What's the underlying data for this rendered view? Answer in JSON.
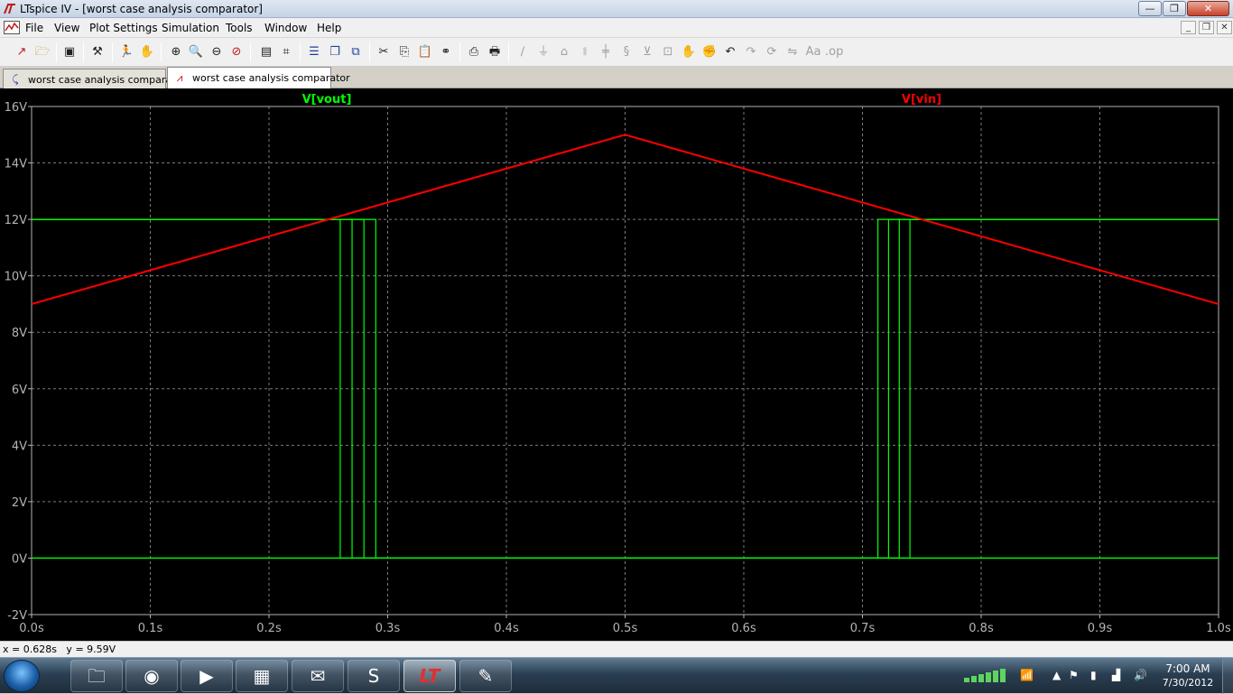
{
  "window": {
    "title": "LTspice IV - [worst case analysis comparator]",
    "minimize_glyph": "—",
    "maximize_glyph": "❐",
    "close_glyph": "✕"
  },
  "menu": {
    "items": [
      "File",
      "View",
      "Plot Settings",
      "Simulation",
      "Tools",
      "Window",
      "Help"
    ],
    "mdi_buttons": [
      "_",
      "❐",
      "✕"
    ]
  },
  "toolbar": {
    "icons": [
      "new-schematic-icon",
      "open-icon",
      "save-icon",
      "control-panel-icon",
      "run-icon",
      "halt-icon",
      "zoom-in-icon",
      "zoom-full-icon",
      "zoom-out-icon",
      "cancel-zoom-icon",
      "autorange-icon",
      "add-trace-icon",
      "tile-horizontal-icon",
      "cascade-icon",
      "close-all-icon",
      "cut-icon",
      "copy-icon",
      "paste-icon",
      "find-icon",
      "print-preview-icon",
      "print-icon",
      "wire-icon",
      "ground-icon",
      "label-icon",
      "resistor-icon",
      "capacitor-icon",
      "inductor-icon",
      "diode-icon",
      "component-icon",
      "move-icon",
      "drag-icon",
      "undo-icon",
      "redo-icon",
      "rotate-icon",
      "mirror-icon",
      "text-icon",
      "spice-directive-icon"
    ]
  },
  "tabs": [
    {
      "label": "worst case analysis comparator",
      "icon": "schematic-tab-icon",
      "active": false
    },
    {
      "label": "worst case analysis comparator",
      "icon": "waveform-tab-icon",
      "active": true
    }
  ],
  "plot": {
    "background": "#000000",
    "grid_color": "#7a7a7a",
    "axis_color": "#b4b4b4",
    "traces": [
      {
        "label": "V[vout]",
        "color": "#00ff00"
      },
      {
        "label": "V[vin]",
        "color": "#ff0000"
      }
    ]
  },
  "chart_data": {
    "type": "line",
    "title": "",
    "xlabel": "",
    "ylabel": "",
    "xlim": [
      0.0,
      1.0
    ],
    "ylim": [
      -2,
      16
    ],
    "x_ticks": [
      "0.0s",
      "0.1s",
      "0.2s",
      "0.3s",
      "0.4s",
      "0.5s",
      "0.6s",
      "0.7s",
      "0.8s",
      "0.9s",
      "1.0s"
    ],
    "x_tick_values": [
      0.0,
      0.1,
      0.2,
      0.3,
      0.4,
      0.5,
      0.6,
      0.7,
      0.8,
      0.9,
      1.0
    ],
    "y_ticks": [
      "-2V",
      "0V",
      "2V",
      "4V",
      "6V",
      "8V",
      "10V",
      "12V",
      "14V",
      "16V"
    ],
    "y_tick_values": [
      -2,
      0,
      2,
      4,
      6,
      8,
      10,
      12,
      14,
      16
    ],
    "grid": true,
    "legend": "top",
    "series": [
      {
        "name": "V[vin]",
        "color": "#ff0000",
        "x": [
          0.0,
          0.5,
          1.0
        ],
        "y": [
          9,
          15,
          9
        ]
      },
      {
        "name": "V[vout]",
        "color": "#00ff00",
        "step_groups": [
          {
            "x": [
              0.0,
              0.26,
              0.26,
              1.0
            ],
            "y": [
              12,
              12,
              0,
              0
            ]
          },
          {
            "x": [
              0.0,
              0.27,
              0.27,
              1.0
            ],
            "y": [
              12,
              12,
              0,
              0
            ]
          },
          {
            "x": [
              0.0,
              0.28,
              0.28,
              1.0
            ],
            "y": [
              12,
              12,
              0,
              0
            ]
          },
          {
            "x": [
              0.0,
              0.29,
              0.29,
              1.0
            ],
            "y": [
              12,
              12,
              0,
              0
            ]
          },
          {
            "x": [
              0.0,
              0.0,
              0.713,
              0.713,
              1.0
            ],
            "y": [
              0,
              0,
              0,
              12,
              12
            ]
          },
          {
            "x": [
              0.0,
              0.0,
              0.722,
              0.722,
              1.0
            ],
            "y": [
              0,
              0,
              0,
              12,
              12
            ]
          },
          {
            "x": [
              0.0,
              0.0,
              0.731,
              0.731,
              1.0
            ],
            "y": [
              0,
              0,
              0,
              12,
              12
            ]
          },
          {
            "x": [
              0.0,
              0.0,
              0.74,
              0.74,
              1.0
            ],
            "y": [
              0,
              0,
              0,
              12,
              12
            ]
          }
        ]
      }
    ]
  },
  "status": {
    "text": "x = 0.628s   y = 9.59V"
  },
  "taskbar": {
    "apps": [
      {
        "name": "explorer",
        "glyph": "🗀"
      },
      {
        "name": "firefox",
        "glyph": "◉"
      },
      {
        "name": "media-player",
        "glyph": "▶"
      },
      {
        "name": "calculator",
        "glyph": "▦"
      },
      {
        "name": "outlook",
        "glyph": "✉"
      },
      {
        "name": "skype",
        "glyph": "S"
      },
      {
        "name": "ltspice",
        "glyph": "LT"
      },
      {
        "name": "paint",
        "glyph": "✎"
      }
    ],
    "clock_time": "7:00 AM",
    "clock_date": "7/30/2012"
  }
}
